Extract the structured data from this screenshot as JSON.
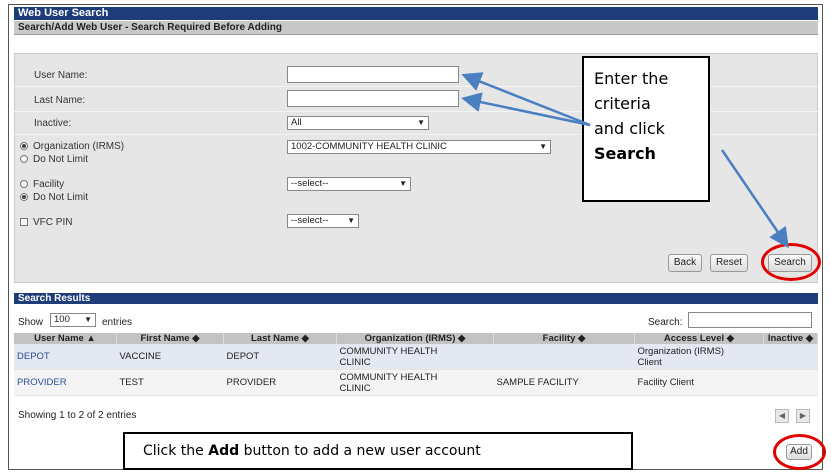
{
  "header": {
    "title": "Web User Search",
    "subtitle": "Search/Add Web User - Search Required Before Adding"
  },
  "form": {
    "user_name_label": "User Name:",
    "user_name_value": "",
    "last_name_label": "Last Name:",
    "last_name_value": "",
    "inactive_label": "Inactive:",
    "inactive_value": "All",
    "org_radio_label": "Organization (IRMS)",
    "org_value": "1002-COMMUNITY HEALTH CLINIC",
    "org_do_not_limit_label": "Do Not Limit",
    "facility_radio_label": "Facility",
    "facility_value": "--select--",
    "facility_do_not_limit_label": "Do Not Limit",
    "vfc_pin_label": "VFC PIN",
    "vfc_pin_value": "--select--"
  },
  "actions": {
    "back": "Back",
    "reset": "Reset",
    "search": "Search"
  },
  "callout_search": {
    "line1": "Enter the",
    "line2": "criteria",
    "line3": "and click",
    "line4": "Search"
  },
  "results": {
    "title": "Search Results",
    "show_label": "Show",
    "show_value": "100",
    "entries_label": "entries",
    "search_label": "Search:",
    "search_value": "",
    "columns": [
      "User Name",
      "First Name",
      "Last Name",
      "Organization (IRMS)",
      "Facility",
      "Access Level",
      "Inactive"
    ],
    "rows": [
      {
        "user_name": "DEPOT",
        "first_name": "VACCINE",
        "last_name": "DEPOT",
        "org_line1": "COMMUNITY HEALTH",
        "org_line2": "CLINIC",
        "facility": "",
        "access_line1": "Organization (IRMS)",
        "access_line2": "Client",
        "inactive": ""
      },
      {
        "user_name": "PROVIDER",
        "first_name": "TEST",
        "last_name": "PROVIDER",
        "org_line1": "COMMUNITY HEALTH",
        "org_line2": "CLINIC",
        "facility": "SAMPLE FACILITY",
        "access_line1": "Facility Client",
        "access_line2": "",
        "inactive": ""
      }
    ],
    "summary": "Showing 1 to 2 of 2 entries",
    "add_button": "Add"
  },
  "callout_add": {
    "pre": "Click the ",
    "bold": "Add",
    "post": " button to add a new user account"
  },
  "colors": {
    "header_blue": "#1f3c7a",
    "highlight_red": "#e00000",
    "arrow_blue": "#4a7fc1"
  }
}
